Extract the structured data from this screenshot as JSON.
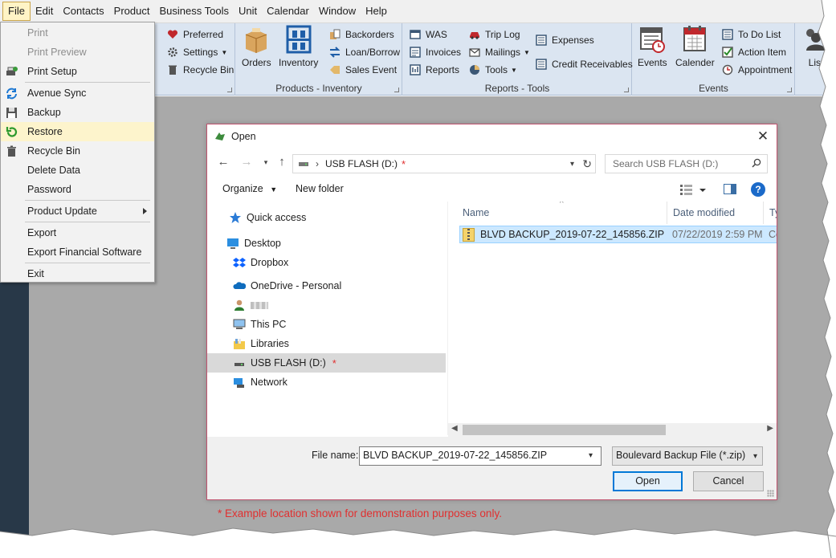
{
  "menubar": {
    "items": [
      "File",
      "Edit",
      "Contacts",
      "Product",
      "Business Tools",
      "Unit",
      "Calendar",
      "Window",
      "Help"
    ]
  },
  "ribbon": {
    "general": {
      "preferred": "Preferred",
      "settings": "Settings",
      "recycle_bin": "Recycle Bin"
    },
    "products_inventory": {
      "label": "Products - Inventory",
      "orders": "Orders",
      "inventory": "Inventory",
      "backorders": "Backorders",
      "loan_borrow": "Loan/Borrow",
      "sales_event": "Sales Event"
    },
    "reports_tools": {
      "label": "Reports - Tools",
      "was": "WAS",
      "invoices": "Invoices",
      "reports": "Reports",
      "trip_log": "Trip Log",
      "mailings": "Mailings",
      "tools": "Tools",
      "expenses": "Expenses",
      "credit_receivables": "Credit Receivables"
    },
    "events": {
      "label": "Events",
      "events": "Events",
      "calender": "Calender",
      "to_do_list": "To Do List",
      "action_item": "Action Item",
      "appointment": "Appointment"
    },
    "list": {
      "list": "List"
    }
  },
  "file_menu": {
    "print": "Print",
    "print_preview": "Print Preview",
    "print_setup": "Print Setup",
    "avenue_sync": "Avenue Sync",
    "backup": "Backup",
    "restore": "Restore",
    "recycle_bin": "Recycle Bin",
    "delete_data": "Delete Data",
    "password": "Password",
    "product_update": "Product Update",
    "export": "Export",
    "export_financial": "Export Financial Software",
    "exit": "Exit"
  },
  "dialog": {
    "title": "Open",
    "address": "USB FLASH (D:)",
    "search_placeholder": "Search USB FLASH (D:)",
    "organize": "Organize",
    "new_folder": "New folder",
    "nav": {
      "quick_access": "Quick access",
      "desktop": "Desktop",
      "dropbox": "Dropbox",
      "onedrive": "OneDrive - Personal",
      "this_pc": "This PC",
      "libraries": "Libraries",
      "usb_flash": "USB FLASH (D:)",
      "network": "Network"
    },
    "columns": {
      "name": "Name",
      "date_modified": "Date modified",
      "type": "Ty"
    },
    "file": {
      "name": "BLVD BACKUP_2019-07-22_145856.ZIP",
      "date": "07/22/2019 2:59 PM",
      "type": "Co"
    },
    "file_name_label": "File name:",
    "file_name_value": "BLVD BACKUP_2019-07-22_145856.ZIP",
    "file_type": "Boulevard Backup File (*.zip)",
    "open_button": "Open",
    "cancel_button": "Cancel"
  },
  "marker": "*",
  "footnote": "* Example location shown for demonstration purposes only.",
  "colors": {
    "ribbon": "#dbe5f1",
    "menu_highlight": "#fdf4cc",
    "selection": "#cce8ff",
    "accent": "#0078d7",
    "note_red": "#e03030",
    "workspace": "#a9a9a9"
  }
}
